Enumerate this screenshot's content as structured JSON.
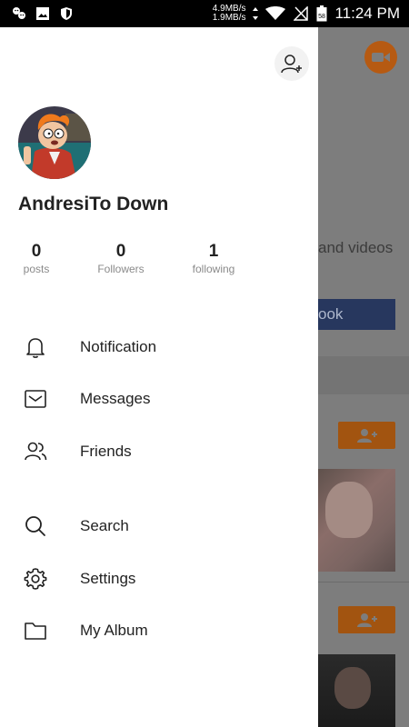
{
  "status_bar": {
    "icons": [
      "wechat-icon",
      "gallery-icon",
      "shield-icon"
    ],
    "net_up": "4.9MB/s",
    "net_down": "1.9MB/s",
    "time": "11:24 PM"
  },
  "profile": {
    "username": "AndresiTo Down",
    "stats": [
      {
        "count": "0",
        "label": "posts"
      },
      {
        "count": "0",
        "label": "Followers"
      },
      {
        "count": "1",
        "label": "following"
      }
    ]
  },
  "menu": {
    "items": [
      {
        "label": "Notification",
        "icon": "bell-icon"
      },
      {
        "label": "Messages",
        "icon": "envelope-icon"
      },
      {
        "label": "Friends",
        "icon": "people-icon"
      },
      {
        "label": "Search",
        "icon": "search-icon"
      },
      {
        "label": "Settings",
        "icon": "gear-icon"
      },
      {
        "label": "My Album",
        "icon": "folder-icon"
      }
    ]
  },
  "background": {
    "text": "and videos",
    "button_label": "ook"
  },
  "colors": {
    "accent_orange": "#a25410",
    "facebook_blue": "#27375e"
  }
}
